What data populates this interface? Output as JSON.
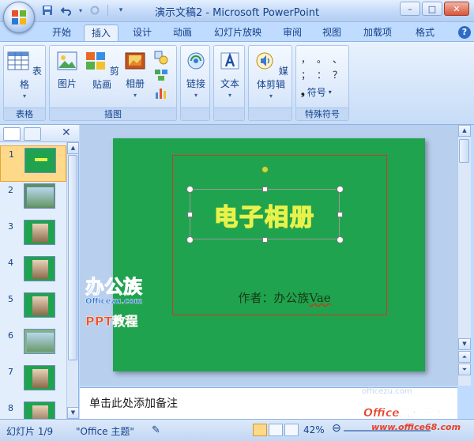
{
  "window": {
    "title": "演示文稿2 - Microsoft PowerPoint",
    "minimize": "–",
    "maximize": "□",
    "close": "✕"
  },
  "quick_access": {
    "save_icon": "save-icon",
    "undo_icon": "undo-icon",
    "redo_icon": "redo-icon",
    "more_icon": "customize-icon"
  },
  "tabs": [
    {
      "label": "开始",
      "active": false
    },
    {
      "label": "插入",
      "active": true
    },
    {
      "label": "设计",
      "active": false
    },
    {
      "label": "动画",
      "active": false
    },
    {
      "label": "幻灯片放映",
      "active": false
    },
    {
      "label": "审阅",
      "active": false
    },
    {
      "label": "视图",
      "active": false
    },
    {
      "label": "加载项",
      "active": false
    },
    {
      "label": "格式",
      "active": false
    }
  ],
  "help": "?",
  "ribbon": {
    "groups": [
      {
        "label": "表格",
        "buttons": [
          {
            "label": "表格",
            "icon": "table-icon"
          }
        ]
      },
      {
        "label": "插图",
        "buttons": [
          {
            "label": "图片",
            "icon": "picture-icon"
          },
          {
            "label": "剪贴画",
            "icon": "clipart-icon"
          },
          {
            "label": "相册",
            "icon": "photo-album-icon"
          }
        ],
        "small_icons": [
          "shapes-icon",
          "smartart-icon",
          "chart-icon"
        ]
      },
      {
        "label": "",
        "buttons": [
          {
            "label": "链接",
            "icon": "link-icon"
          }
        ]
      },
      {
        "label": "",
        "buttons": [
          {
            "label": "文本",
            "icon": "text-icon"
          }
        ]
      },
      {
        "label": "",
        "buttons": [
          {
            "label": "媒体剪辑",
            "icon": "media-icon"
          }
        ]
      },
      {
        "label": "特殊符号",
        "symbols": [
          "，",
          "。",
          "、",
          "；",
          "：",
          "？"
        ],
        "buttons": [
          {
            "label": "符号",
            "icon": "symbol-icon"
          }
        ]
      }
    ]
  },
  "slides_pane": {
    "slides": [
      {
        "number": "1",
        "selected": true,
        "color": "#20a34e"
      },
      {
        "number": "2",
        "selected": false,
        "color": "#5b8f6e"
      },
      {
        "number": "3",
        "selected": false,
        "color": "#20a34e"
      },
      {
        "number": "4",
        "selected": false,
        "color": "#20a34e"
      },
      {
        "number": "5",
        "selected": false,
        "color": "#20a34e"
      },
      {
        "number": "6",
        "selected": false,
        "color": "#7fb38a"
      },
      {
        "number": "7",
        "selected": false,
        "color": "#20a34e"
      },
      {
        "number": "8",
        "selected": false,
        "color": "#20a34e"
      }
    ]
  },
  "slide": {
    "title": "电子相册",
    "subtitle_prefix": "作者：办公族",
    "subtitle_name": "Vae",
    "background": "#20a34e"
  },
  "notes": {
    "placeholder": "单击此处添加备注"
  },
  "status_bar": {
    "slide_info": "幻灯片 1/9",
    "theme": "\"Office 主题\"",
    "zoom": "42%"
  },
  "watermarks": {
    "left_brand": "办公族",
    "left_domain": "Officezu.com",
    "left_ppt": "PPT教程",
    "right_domain": "officezu.com",
    "right_brand": "Office教程学习网",
    "right_url": "www.office68.com"
  }
}
